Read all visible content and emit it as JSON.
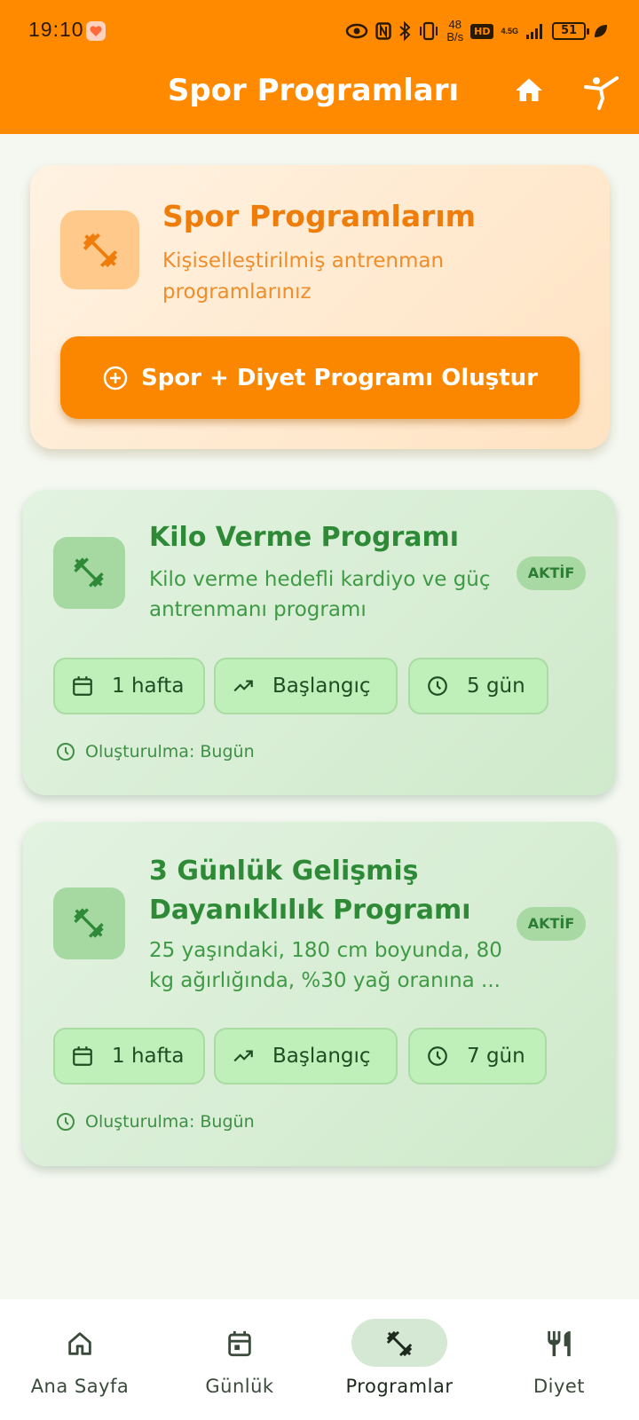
{
  "status_bar": {
    "time": "19:10",
    "net_speed_value": "48",
    "net_speed_unit": "B/s",
    "hd_label": "HD",
    "signal_label": "4.5G",
    "battery": "51"
  },
  "app_bar": {
    "title": "Spor Programları"
  },
  "hero": {
    "title": "Spor Programlarım",
    "subtitle": "Kişiselleştirilmiş antrenman programlarınız",
    "create_button_label": "Spor + Diyet Programı Oluştur"
  },
  "programs": [
    {
      "title": "Kilo Verme Programı",
      "description": "Kilo verme hedefli kardiyo ve güç antrenmanı programı",
      "badge": "AKTİF",
      "duration": "1 hafta",
      "level": "Başlangıç",
      "days": "5 gün",
      "created": "Oluşturulma: Bugün"
    },
    {
      "title": "3 Günlük Gelişmiş Dayanıklılık Programı",
      "description": "25 yaşındaki, 180 cm boyunda, 80 kg ağırlığında, %30 yağ oranına ...",
      "badge": "AKTİF",
      "duration": "1 hafta",
      "level": "Başlangıç",
      "days": "7 gün",
      "created": "Oluşturulma: Bugün"
    }
  ],
  "bottom_nav": {
    "items": [
      {
        "label": "Ana Sayfa",
        "icon": "home-outline-icon"
      },
      {
        "label": "Günlük",
        "icon": "calendar-icon"
      },
      {
        "label": "Programlar",
        "icon": "dumbbell-icon",
        "active": true
      },
      {
        "label": "Diyet",
        "icon": "fork-knife-icon"
      }
    ]
  },
  "colors": {
    "primary_orange": "#ff8a00",
    "green_title": "#2f8a38",
    "card_green": "#cfe9cb",
    "chip_green": "#bff0ba"
  }
}
